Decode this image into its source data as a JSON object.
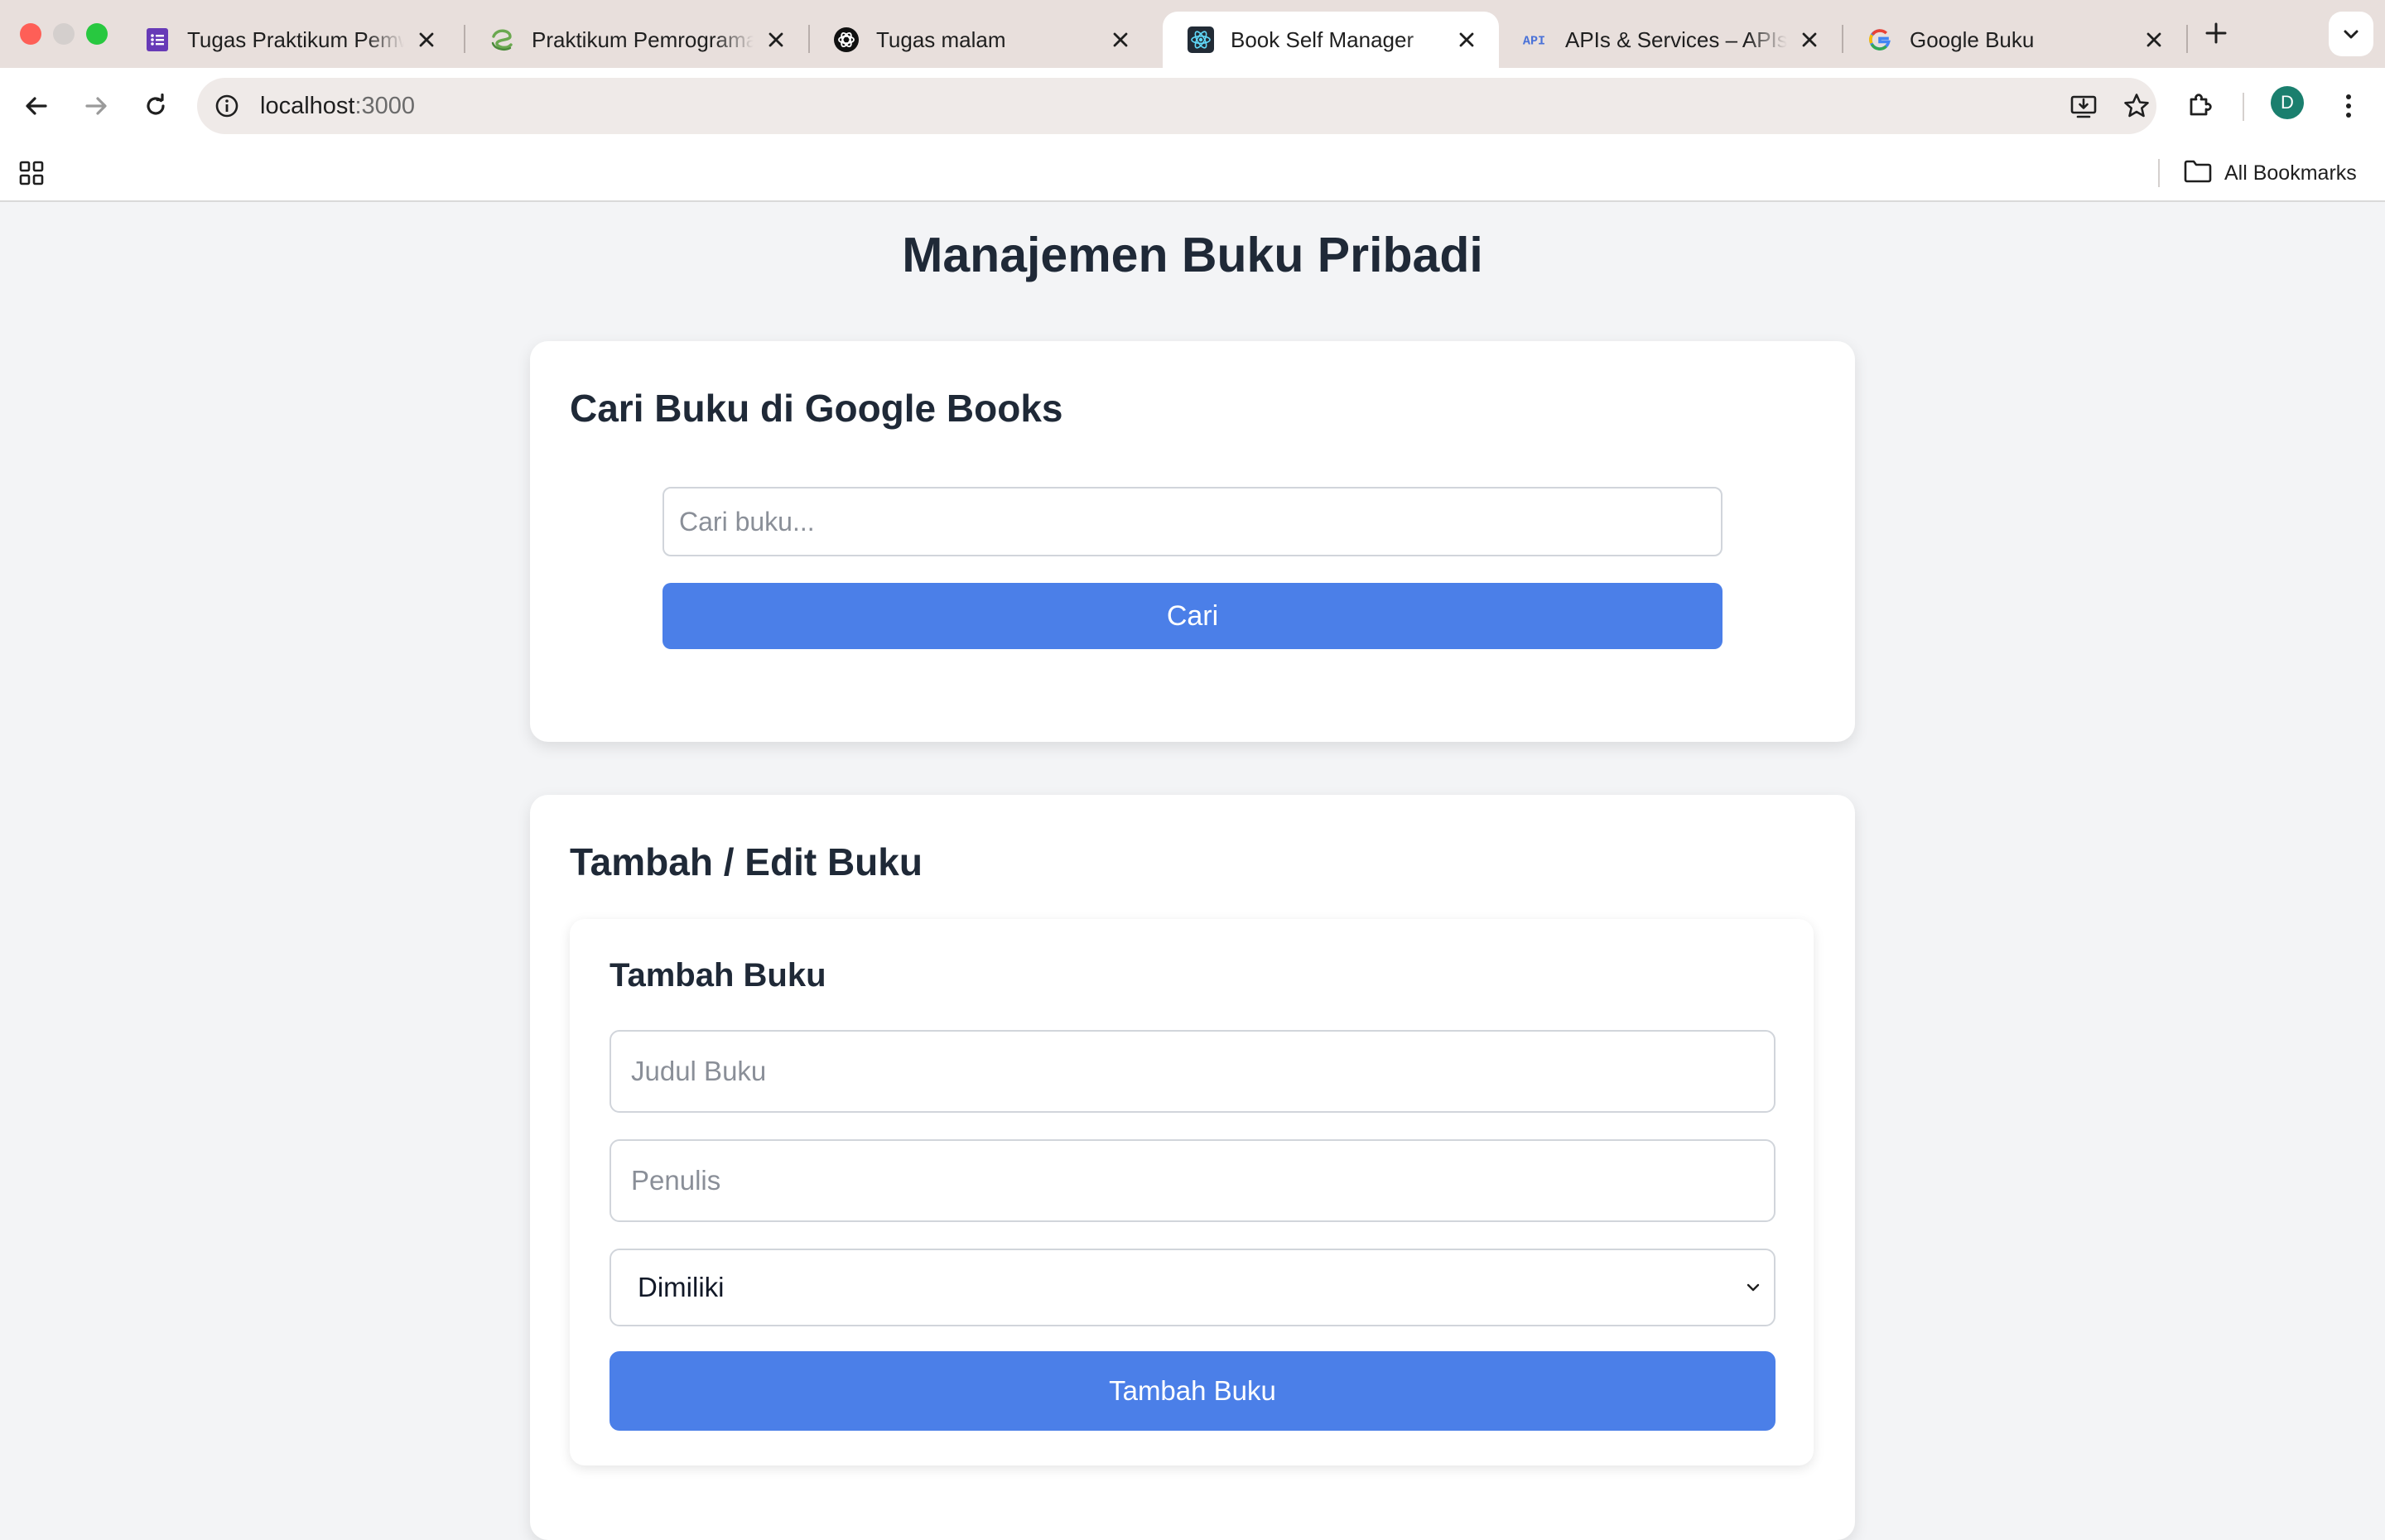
{
  "browser": {
    "tabs": [
      {
        "title": "Tugas Praktikum Pemwe",
        "icon": "google-forms-icon",
        "active": false
      },
      {
        "title": "Praktikum Pemrograman",
        "icon": "swirl-logo-icon",
        "active": false
      },
      {
        "title": "Tugas malam",
        "icon": "openai-icon",
        "active": false
      },
      {
        "title": "Book Self Manager",
        "icon": "react-icon",
        "active": true
      },
      {
        "title": "APIs & Services – APIs &",
        "icon": "api-icon",
        "active": false
      },
      {
        "title": "Google Buku",
        "icon": "google-icon",
        "active": false
      }
    ],
    "api_favicon_text": "API",
    "url_host": "localhost",
    "url_port": ":3000",
    "profile_initial": "D",
    "all_bookmarks_label": "All Bookmarks"
  },
  "page": {
    "title": "Manajemen Buku Pribadi",
    "search_section": {
      "heading": "Cari Buku di Google Books",
      "input_placeholder": "Cari buku...",
      "input_value": "",
      "button_label": "Cari"
    },
    "form_section": {
      "heading": "Tambah / Edit Buku",
      "form_title": "Tambah Buku",
      "title_placeholder": "Judul Buku",
      "author_placeholder": "Penulis",
      "status_selected": "Dimiliki",
      "submit_label": "Tambah Buku"
    }
  },
  "colors": {
    "accent_button": "#4b7fe8",
    "page_background": "#f3f4f6",
    "heading_text": "#1f2937",
    "tabbar_background": "#e8dfdc"
  }
}
